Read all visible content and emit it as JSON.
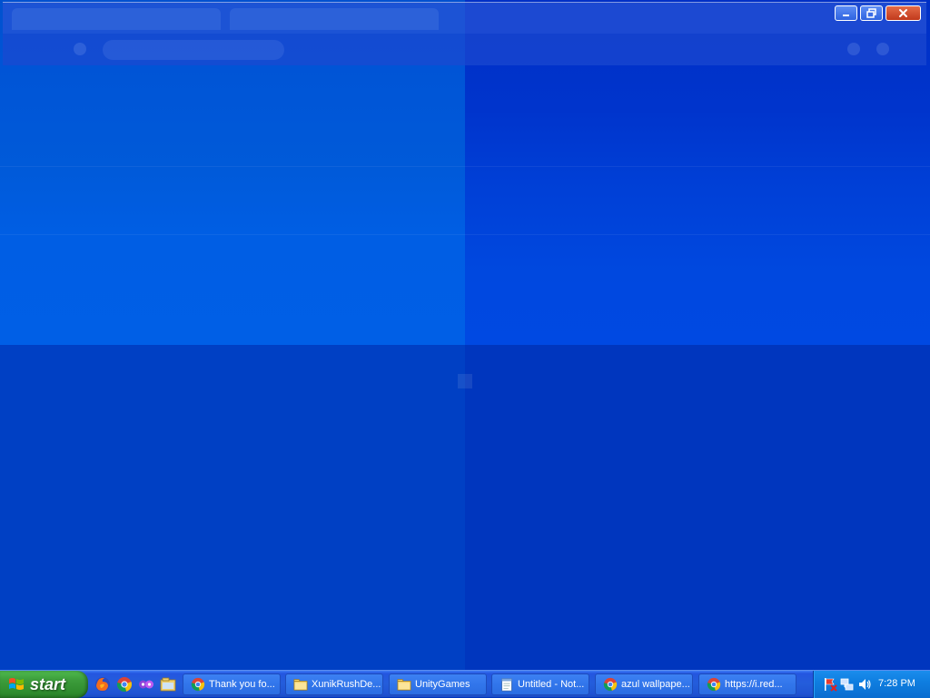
{
  "window": {
    "controls": {
      "minimize_icon": "minimize-icon",
      "restore_icon": "restore-icon",
      "close_icon": "close-icon"
    }
  },
  "taskbar": {
    "start_label": "start",
    "quick_launch": [
      {
        "icon": "firefox-icon"
      },
      {
        "icon": "chrome-icon"
      },
      {
        "icon": "messenger-icon"
      },
      {
        "icon": "explorer-folder-icon"
      }
    ],
    "tasks": [
      {
        "label": "Thank you fo...",
        "icon": "chrome-icon"
      },
      {
        "label": "XunikRushDe...",
        "icon": "folder-icon"
      },
      {
        "label": "UnityGames",
        "icon": "folder-icon"
      },
      {
        "label": "Untitled - Not...",
        "icon": "notepad-icon"
      },
      {
        "label": "azul wallpape...",
        "icon": "chrome-icon"
      },
      {
        "label": "https://i.red...",
        "icon": "chrome-icon"
      }
    ],
    "tray": {
      "icons": [
        "security-alert-icon",
        "network-icon",
        "volume-icon"
      ],
      "clock": "7:28 PM"
    }
  },
  "colors": {
    "taskbar": "#245ddb",
    "start_button": "#3d9d3c",
    "tray": "#0f7ee0",
    "desktop_blue": "#0036bd"
  }
}
